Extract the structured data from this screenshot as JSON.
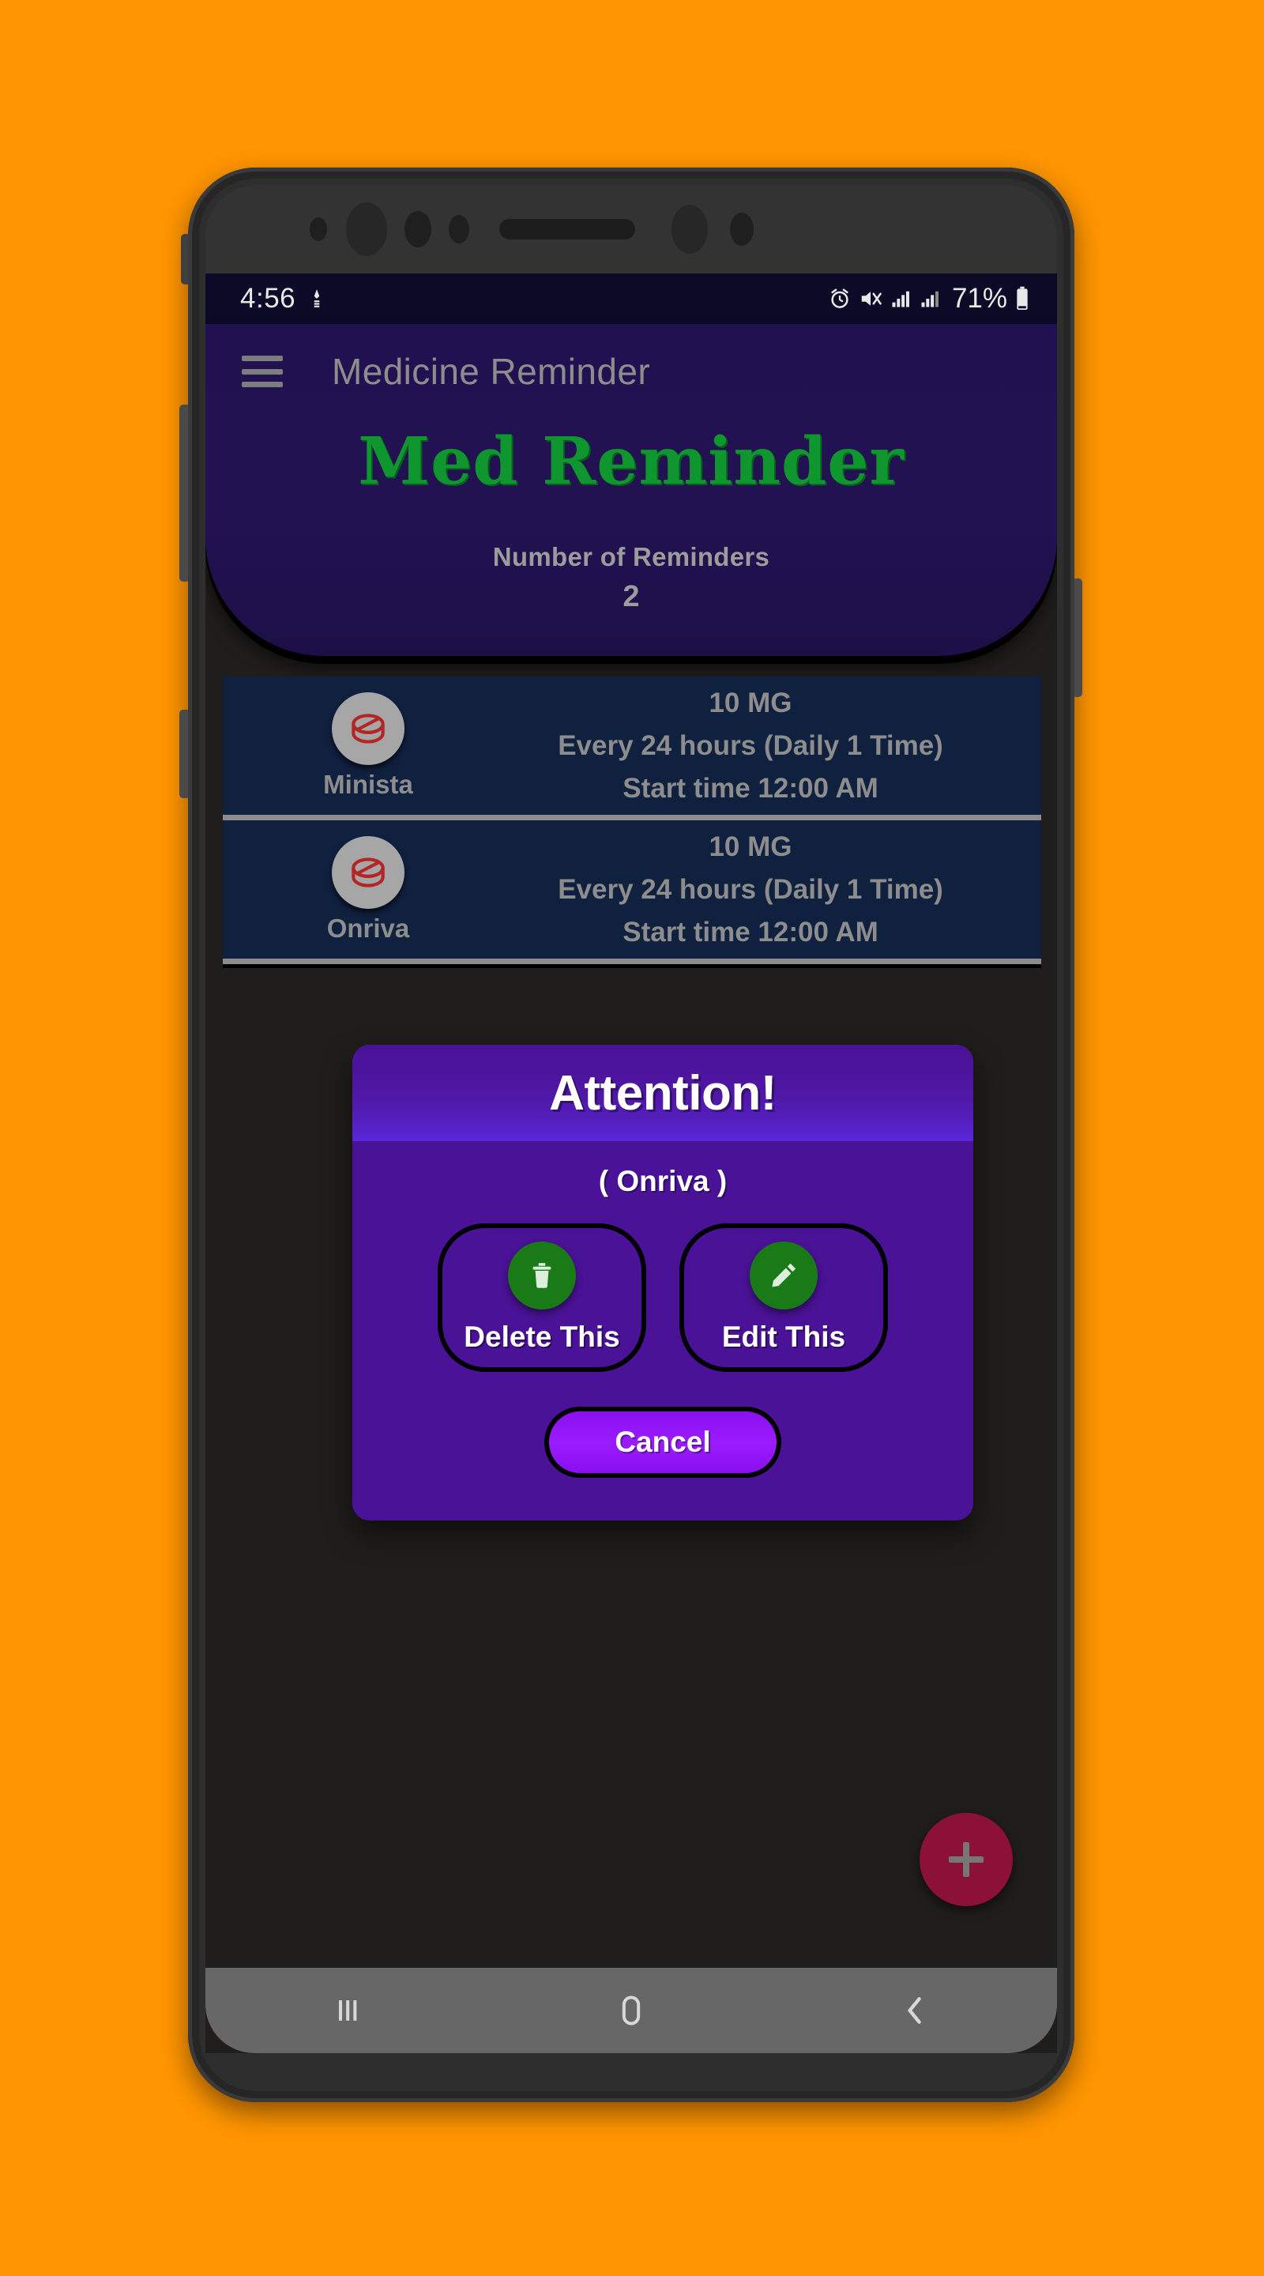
{
  "background_color": "#ff9500",
  "status_bar": {
    "time": "4:56",
    "battery_percent": "71%",
    "icons": [
      "stylus-icon",
      "alarm-icon",
      "mute-icon",
      "signal-icon",
      "signal-icon",
      "battery-icon"
    ]
  },
  "app_bar": {
    "menu_icon": "hamburger-menu-icon",
    "title": "Medicine Reminder"
  },
  "header": {
    "brand_title": "Med Reminder",
    "brand_color": "#10962f",
    "count_label": "Number of Reminders",
    "count_value": "2"
  },
  "reminders": [
    {
      "icon": "pill-icon",
      "name": "Minista",
      "dose": "10 MG",
      "frequency": "Every 24 hours (Daily 1 Time)",
      "start": "Start time 12:00 AM"
    },
    {
      "icon": "pill-icon",
      "name": "Onriva",
      "dose": "10 MG",
      "frequency": "Every 24 hours (Daily 1 Time)",
      "start": "Start time 12:00 AM"
    }
  ],
  "fab": {
    "icon": "plus-icon",
    "color": "#8b1236"
  },
  "dialog": {
    "title": "Attention!",
    "subtitle": "( Onriva )",
    "delete_label": "Delete This",
    "delete_icon": "trash-icon",
    "edit_label": "Edit This",
    "edit_icon": "pencil-icon",
    "cancel_label": "Cancel",
    "accent_color": "#4a1296",
    "icon_circle_color": "#1a7a18",
    "cancel_color": "#9a1cff"
  },
  "nav_bar": {
    "recents": "recents-icon",
    "home": "home-icon",
    "back": "back-icon"
  }
}
